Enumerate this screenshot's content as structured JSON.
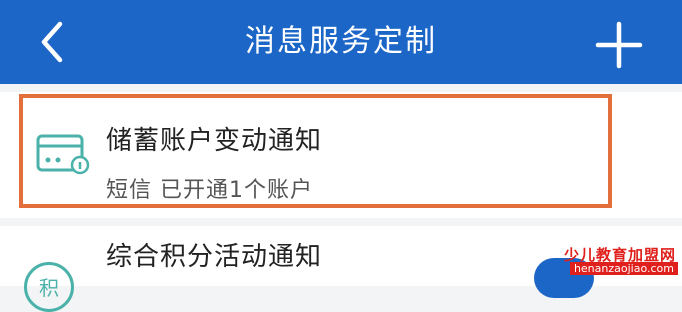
{
  "header": {
    "title": "消息服务定制",
    "background": "#1c66c7",
    "left_icon": "chevron-left-icon",
    "right_icon": "plus-icon"
  },
  "items": [
    {
      "title": "储蓄账户变动通知",
      "subtitle": "短信 已开通1个账户",
      "icon": "card-icon",
      "highlight_color": "#e26f3c"
    },
    {
      "title": "综合积分活动通知",
      "icon_glyph": "积",
      "icon": "points-icon",
      "toggle_on": true,
      "toggle_color": "#1c66c7"
    }
  ],
  "watermark": {
    "text": "少儿教育加盟网",
    "url": "henanzaojiao.com"
  }
}
